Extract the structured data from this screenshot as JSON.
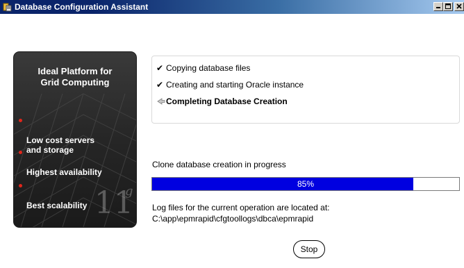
{
  "window": {
    "title": "Database Configuration Assistant"
  },
  "banner": {
    "title": "Ideal Platform for\nGrid Computing",
    "bullets": [
      "Low cost servers\nand storage",
      "Highest availability",
      "Best scalability"
    ],
    "brand_number": "11",
    "brand_letter": "g",
    "bullet_color": "#e0261b"
  },
  "steps": [
    {
      "label": "Copying database files",
      "status": "done",
      "icon": "checkmark-icon"
    },
    {
      "label": "Creating and starting Oracle instance",
      "status": "done",
      "icon": "checkmark-icon"
    },
    {
      "label": "Completing Database Creation",
      "status": "in-progress",
      "icon": "current-step-arrow-icon"
    }
  ],
  "progress": {
    "label": "Clone database creation in progress",
    "value": 85,
    "text": "85%",
    "fill_color": "#0000e0"
  },
  "log": {
    "line1": "Log files for the current operation are located at:",
    "line2": "C:\\app\\epmrapid\\cfgtoollogs\\dbca\\epmrapid"
  },
  "buttons": {
    "stop_label": "Stop"
  }
}
